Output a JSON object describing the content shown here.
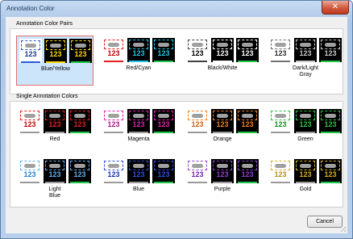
{
  "window": {
    "title": "Annotation Color",
    "close_glyph": "✕"
  },
  "pairs": {
    "title": "Annotation Color Pairs",
    "tiles": [
      {
        "label": "Blue/Yellow",
        "selected": true,
        "boxes": [
          {
            "bg": "#ffffff",
            "dash": "#2a5bd7",
            "text": "#1d3a8a",
            "num": "123",
            "bar": "#2a5bd7"
          },
          {
            "bg": "#000000",
            "dash": "#ffd700",
            "text": "#ffd700",
            "num": "123",
            "bar": "#ffd700"
          },
          {
            "bg": "#000000",
            "dash": "#ffd700",
            "text": "#ffd700",
            "num": "123",
            "bar": "#1ec84a"
          }
        ]
      },
      {
        "label": "Red/Cyan",
        "selected": false,
        "boxes": [
          {
            "bg": "#ffffff",
            "dash": "#e02020",
            "text": "#c00000",
            "num": "123",
            "bar": "#e02020"
          },
          {
            "bg": "#000000",
            "dash": "#20c8e8",
            "text": "#20c8e8",
            "num": "123",
            "bar": "#20c8e8"
          },
          {
            "bg": "#000000",
            "dash": "#20c8e8",
            "text": "#20c8e8",
            "num": "123",
            "bar": "#1ec84a"
          }
        ]
      },
      {
        "label": "Black/White",
        "selected": false,
        "boxes": [
          {
            "bg": "#ffffff",
            "dash": "#404040",
            "text": "#000000",
            "num": "123",
            "bar": "#404040"
          },
          {
            "bg": "#000000",
            "dash": "#ffffff",
            "text": "#ffffff",
            "num": "123",
            "bar": "#ffffff"
          },
          {
            "bg": "#000000",
            "dash": "#ffffff",
            "text": "#ffffff",
            "num": "123",
            "bar": "#1ec84a"
          }
        ]
      },
      {
        "label": "Dark/Light\nGray",
        "selected": false,
        "boxes": [
          {
            "bg": "#ffffff",
            "dash": "#707070",
            "text": "#303030",
            "num": "123",
            "bar": "#707070"
          },
          {
            "bg": "#000000",
            "dash": "#c8c8c8",
            "text": "#c8c8c8",
            "num": "123",
            "bar": "#c8c8c8"
          },
          {
            "bg": "#000000",
            "dash": "#c8c8c8",
            "text": "#c8c8c8",
            "num": "123",
            "bar": "#1ec84a"
          }
        ]
      }
    ]
  },
  "singles": {
    "title": "Single Annotation Colors",
    "tiles": [
      {
        "label": "Red",
        "color": "#e02020",
        "text_dark": "#c00000"
      },
      {
        "label": "Magenta",
        "color": "#e020b0",
        "text_dark": "#b0108a"
      },
      {
        "label": "Orange",
        "color": "#f08020",
        "text_dark": "#d06010"
      },
      {
        "label": "Green",
        "color": "#30c040",
        "text_dark": "#109020"
      },
      {
        "label": "Light\nBlue",
        "color": "#60b0f0",
        "text_dark": "#2080d0"
      },
      {
        "label": "Blue",
        "color": "#3050e0",
        "text_dark": "#1030b0"
      },
      {
        "label": "Purple",
        "color": "#9040d0",
        "text_dark": "#7020b0"
      },
      {
        "label": "Gold",
        "color": "#d8b020",
        "text_dark": "#b09010"
      }
    ],
    "num": "123"
  },
  "footer": {
    "cancel_label": "Cancel"
  }
}
